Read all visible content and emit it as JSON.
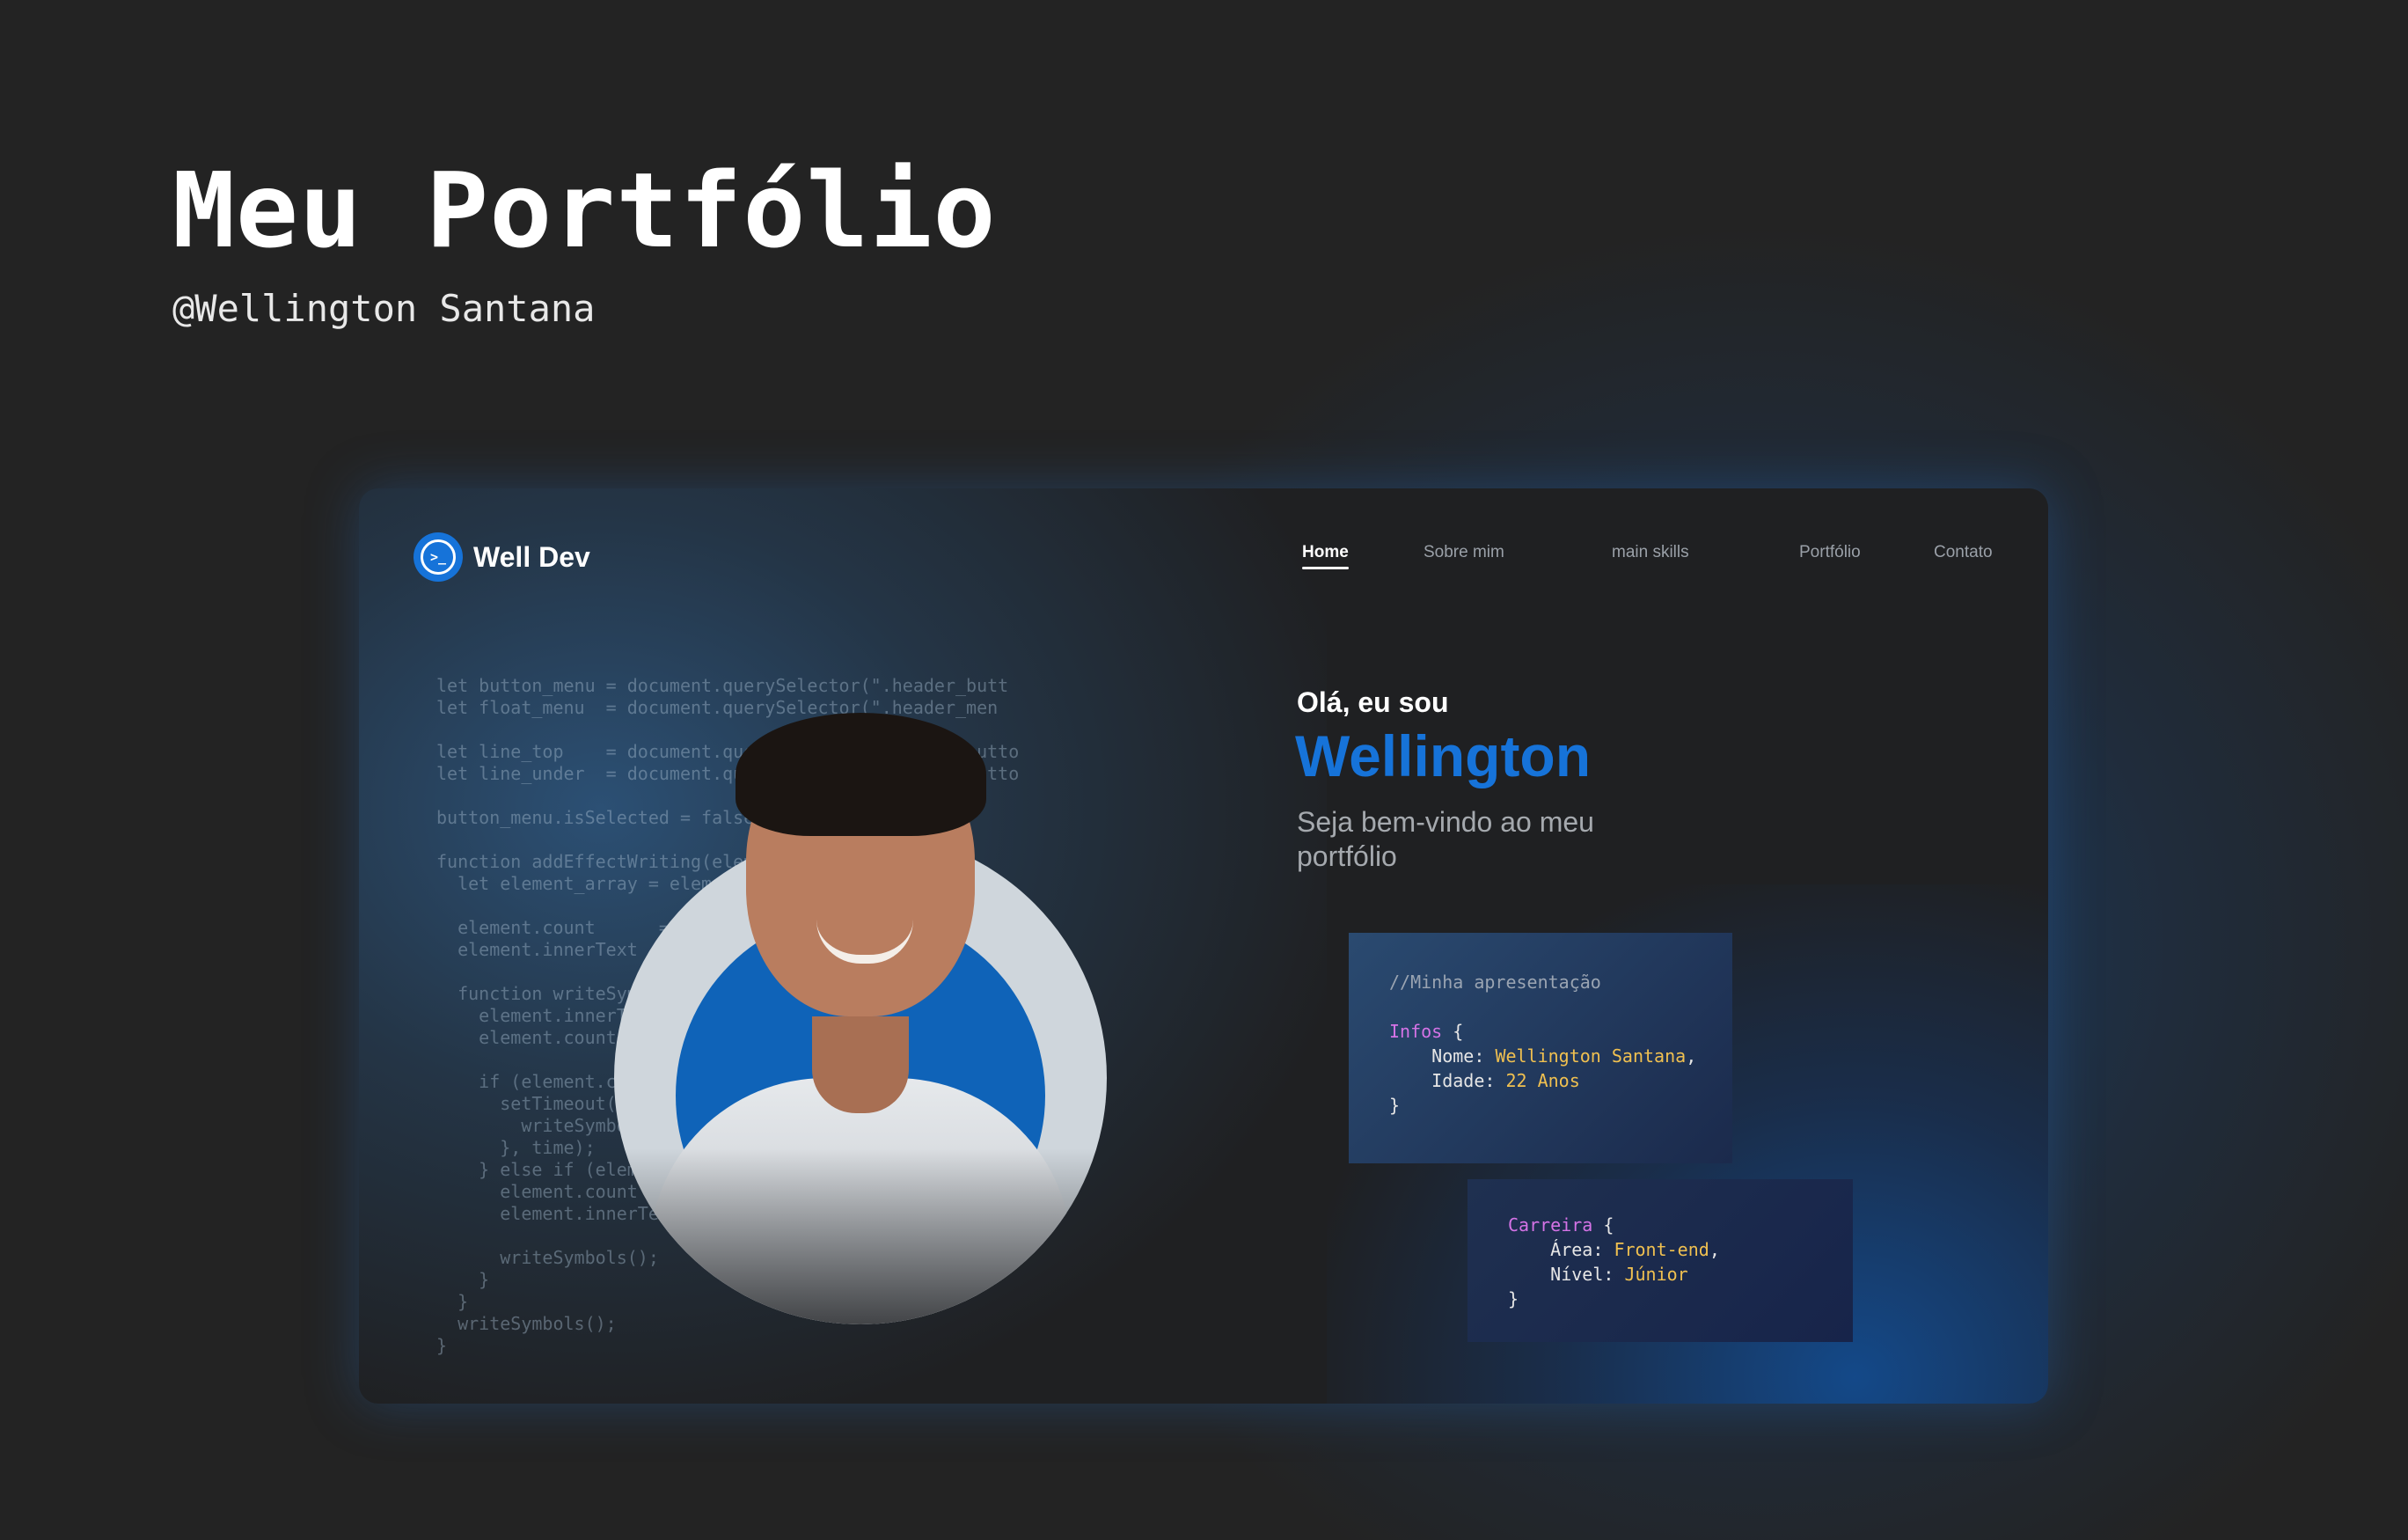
{
  "page": {
    "title": "Meu Portfólio",
    "author": "@Wellington Santana"
  },
  "colors": {
    "accent": "#1673d9",
    "background": "#232323",
    "keyword": "#d573e6",
    "value": "#f0c050"
  },
  "site": {
    "logo_icon": "terminal-icon",
    "logo_icon_glyph": ">_",
    "logo_text": "Well Dev",
    "nav": [
      {
        "label": "Home",
        "active": true
      },
      {
        "label": "Sobre mim",
        "active": false
      },
      {
        "label": "main skills",
        "active": false
      },
      {
        "label": "Portfólio",
        "active": false
      },
      {
        "label": "Contato",
        "active": false
      }
    ],
    "hero": {
      "greeting": "Olá, eu sou",
      "name": "Wellington",
      "tagline": "Seja bem-vindo ao meu portfólio"
    },
    "background_code": "let button_menu = document.querySelector(\".header_butt\nlet float_menu  = document.querySelector(\".header_men\n\nlet line_top    = document.querySelector(\".header_butto\nlet line_under  = document.querySelector(\".header_butto\n\nbutton_menu.isSelected = false\n\nfunction addEffectWriting(element, time) {\n  let element_array = element.innerText.split(\"\")\n\n  element.count      = 0\n  element.innerText  = \"\"\n\n  function writeSymbols() {\n    element.innerText += element_array[element.count]\n    element.count++\n\n    if (element.count < element_array.length) {\n      setTimeout(() => {\n        writeSymbols();\n      }, time);\n    } else if (element.count >= element_array.length) {\n      element.count      = 0\n      element.innerText  = \"\";\n\n      writeSymbols();\n    }\n  }\n  writeSymbols();\n}",
    "card_intro": {
      "comment": "//Minha apresentação",
      "object_name": "Infos",
      "open_brace": "{",
      "fields": [
        {
          "key": "Nome:",
          "value": "Wellington Santana",
          "suffix": ","
        },
        {
          "key": "Idade:",
          "value": "22 Anos",
          "suffix": ""
        }
      ],
      "close_brace": "}"
    },
    "card_career": {
      "object_name": "Carreira",
      "open_brace": "{",
      "fields": [
        {
          "key": "Área:",
          "value": "Front-end",
          "suffix": ","
        },
        {
          "key": "Nível:",
          "value": "Júnior",
          "suffix": ""
        }
      ],
      "close_brace": "}"
    }
  }
}
